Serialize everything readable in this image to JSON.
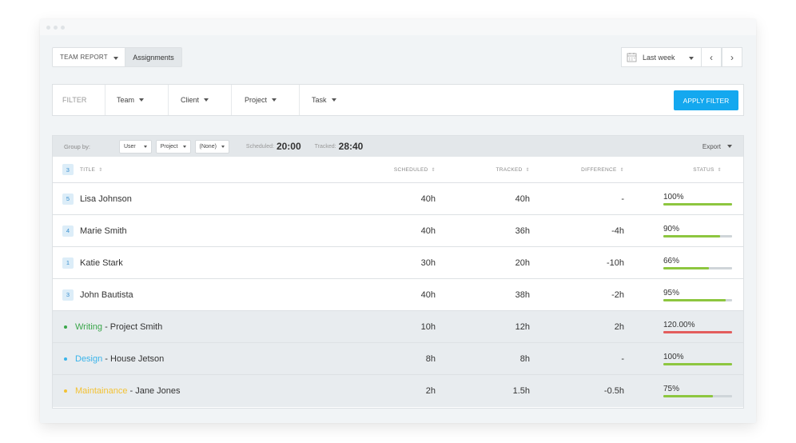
{
  "window": {
    "dots": 3
  },
  "top_bar": {
    "report_select": "TEAM REPORT",
    "assignments_tab": "Assignments",
    "date_range": "Last week",
    "prev": "‹",
    "next": "›"
  },
  "filter_bar": {
    "label": "FILTER",
    "items": [
      "Team",
      "Client",
      "Project",
      "Task"
    ],
    "apply_button": "APPLY FILTER",
    "apply_color": "#14a8ef"
  },
  "group_bar": {
    "label": "Group by:",
    "selects": [
      "User",
      "Project",
      "(None)"
    ],
    "scheduled_label": "Scheduled:",
    "scheduled_value": "20:00",
    "tracked_label": "Tracked:",
    "tracked_value": "28:40",
    "export": "Export"
  },
  "table": {
    "count": "3",
    "headers": {
      "title": "TITLE",
      "scheduled": "SCHEDULED",
      "tracked": "TRACKED",
      "difference": "DIFFERENCE",
      "status": "STATUS"
    },
    "user_rows": [
      {
        "badge": "5",
        "name": "Lisa Johnson",
        "scheduled": "40h",
        "tracked": "40h",
        "difference": "-",
        "status": "100%",
        "progress": 1.0,
        "bar_color": "#8dc63f"
      },
      {
        "badge": "4",
        "name": "Marie Smith",
        "scheduled": "40h",
        "tracked": "36h",
        "difference": "-4h",
        "status": "90%",
        "progress": 0.82,
        "bar_color": "#8dc63f"
      },
      {
        "badge": "1",
        "name": "Katie Stark",
        "scheduled": "30h",
        "tracked": "20h",
        "difference": "-10h",
        "status": "66%",
        "progress": 0.66,
        "bar_color": "#8dc63f"
      },
      {
        "badge": "3",
        "name": "John Bautista",
        "scheduled": "40h",
        "tracked": "38h",
        "difference": "-2h",
        "status": "95%",
        "progress": 0.91,
        "bar_color": "#8dc63f"
      }
    ],
    "task_rows": [
      {
        "task": "Writing",
        "task_color": "#3aa64a",
        "name": " - Project Smith",
        "scheduled": "10h",
        "tracked": "12h",
        "difference": "2h",
        "status": "120.00%",
        "progress": 1.0,
        "bar_color": "#e35d5d"
      },
      {
        "task": "Design",
        "task_color": "#3ab4ea",
        "name": " - House Jetson",
        "scheduled": "8h",
        "tracked": "8h",
        "difference": "-",
        "status": "100%",
        "progress": 1.0,
        "bar_color": "#8dc63f"
      },
      {
        "task": "Maintainance",
        "task_color": "#f3c234",
        "name": " - Jane Jones",
        "scheduled": "2h",
        "tracked": "1.5h",
        "difference": "-0.5h",
        "status": "75%",
        "progress": 0.72,
        "bar_color": "#8dc63f"
      }
    ]
  }
}
